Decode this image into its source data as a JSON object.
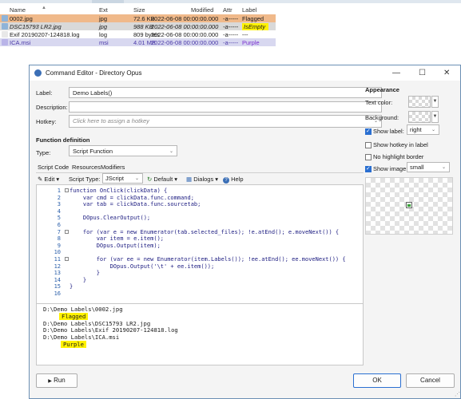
{
  "files": {
    "columns": [
      "Name",
      "Ext",
      "Size",
      "Modified",
      "Attr",
      "Label"
    ],
    "rows": [
      {
        "name": "0002.jpg",
        "ext": "jpg",
        "size": "72.6 KB",
        "modified": "2022-06-08  00:00:00.000",
        "attr": "-a-----",
        "label": "Flagged",
        "bg": "#f0b98a",
        "label_color": "#1a1a1a",
        "label_bg": ""
      },
      {
        "name": "DSC15793 LR2.jpg",
        "ext": "jpg",
        "size": "988 KB",
        "modified": "2022-06-08  00:00:00.000",
        "attr": "-a-----",
        "label": "IsEmpty",
        "bg": "#d9d9d9",
        "label_color": "#1a1a1a",
        "label_bg": "#fff200",
        "italic": true
      },
      {
        "name": "Exif 20190207-124818.log",
        "ext": "log",
        "size": "809 bytes",
        "modified": "2022-06-08  00:00:00.000",
        "attr": "-a-----",
        "label": "---",
        "bg": "#ffffff",
        "label_color": "#1a1a1a",
        "label_bg": ""
      },
      {
        "name": "ICA.msi",
        "ext": "msi",
        "size": "4.01 MB",
        "modified": "2022-06-08  00:00:00.000",
        "attr": "-a-----",
        "label": "Purple",
        "bg": "#d8d8f0",
        "label_color": "#7a2fd0",
        "label_bg": ""
      }
    ]
  },
  "dialog": {
    "title": "Command Editor - Directory Opus",
    "label_caption": "Label:",
    "label_value": "Demo Labels()",
    "description_caption": "Description:",
    "hotkey_caption": "Hotkey:",
    "hotkey_placeholder": "Click here to assign a hotkey",
    "function_definition": "Function definition",
    "type_caption": "Type:",
    "type_value": "Script Function",
    "tabs": [
      "Script Code",
      "Resources",
      "Modifiers"
    ],
    "toolbar": {
      "edit": "Edit",
      "script_type_caption": "Script Type:",
      "script_type_value": "JScript",
      "default": "Default",
      "dialogs": "Dialogs",
      "help": "Help"
    },
    "appearance": {
      "heading": "Appearance",
      "text_color": "Text color:",
      "background": "Background:",
      "show_label": "Show label:",
      "show_label_value": "right",
      "show_hotkey": "Show hotkey in label",
      "no_highlight": "No highlight border",
      "show_image": "Show image:",
      "show_image_value": "small"
    },
    "code_lines": [
      "function OnClick(clickData) {",
      "    var cmd = clickData.func.command;",
      "    var tab = clickData.func.sourcetab;",
      "",
      "    DOpus.ClearOutput();",
      "",
      "    for (var e = new Enumerator(tab.selected_files); !e.atEnd(); e.moveNext()) {",
      "        var item = e.item();",
      "        DOpus.Output(item);",
      "",
      "        for (var ee = new Enumerator(item.Labels()); !ee.atEnd(); ee.moveNext()) {",
      "            DOpus.Output('\\t' + ee.item());",
      "        }",
      "    }",
      "}",
      ""
    ],
    "line_numbers": [
      "1",
      "2",
      "3",
      "4",
      "5",
      "6",
      "7",
      "8",
      "9",
      "10",
      "11",
      "12",
      "13",
      "14",
      "15",
      "16"
    ],
    "output": {
      "line1": "D:\\Demo Labels\\0002.jpg",
      "tag1": "Flagged",
      "line2": "D:\\Demo Labels\\DSC15793 LR2.jpg",
      "line3": "D:\\Demo Labels\\Exif 20190207-124818.log",
      "line4": "D:\\Demo Labels\\ICA.msi",
      "tag2": "Purple"
    },
    "buttons": {
      "run": "Run",
      "ok": "OK",
      "cancel": "Cancel"
    }
  }
}
